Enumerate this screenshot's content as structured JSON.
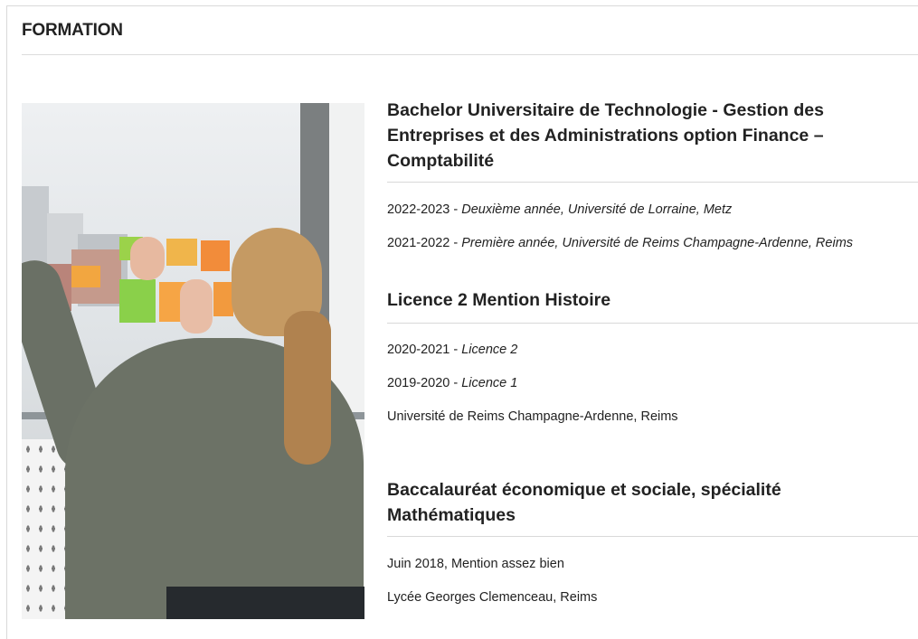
{
  "section": {
    "title": "FORMATION"
  },
  "entries": [
    {
      "title": "Bachelor Universitaire de Technologie - Gestion des Entreprises et des Administrations option Finance – Comptabilité",
      "lines": [
        {
          "year": "2022-2023",
          "sep": " - ",
          "detail": "Deuxième année, Université de Lorraine, Metz"
        },
        {
          "year": "2021-2022",
          "sep": " - ",
          "detail": "Première année, Université de Reims Champagne-Ardenne, Reims"
        }
      ]
    },
    {
      "title": "Licence 2 Mention Histoire",
      "lines": [
        {
          "year": "2020-2021",
          "sep": " - ",
          "detail": "Licence 2"
        },
        {
          "year": "2019-2020",
          "sep": " - ",
          "detail": "Licence 1"
        }
      ],
      "footer": "Université de Reims Champagne-Ardenne, Reims"
    },
    {
      "title": "Baccalauréat économique et sociale, spécialité Mathématiques",
      "lines": [
        {
          "text": "Juin 2018, Mention assez bien"
        },
        {
          "text": "Lycée Georges Clemenceau, Reims"
        }
      ]
    }
  ]
}
